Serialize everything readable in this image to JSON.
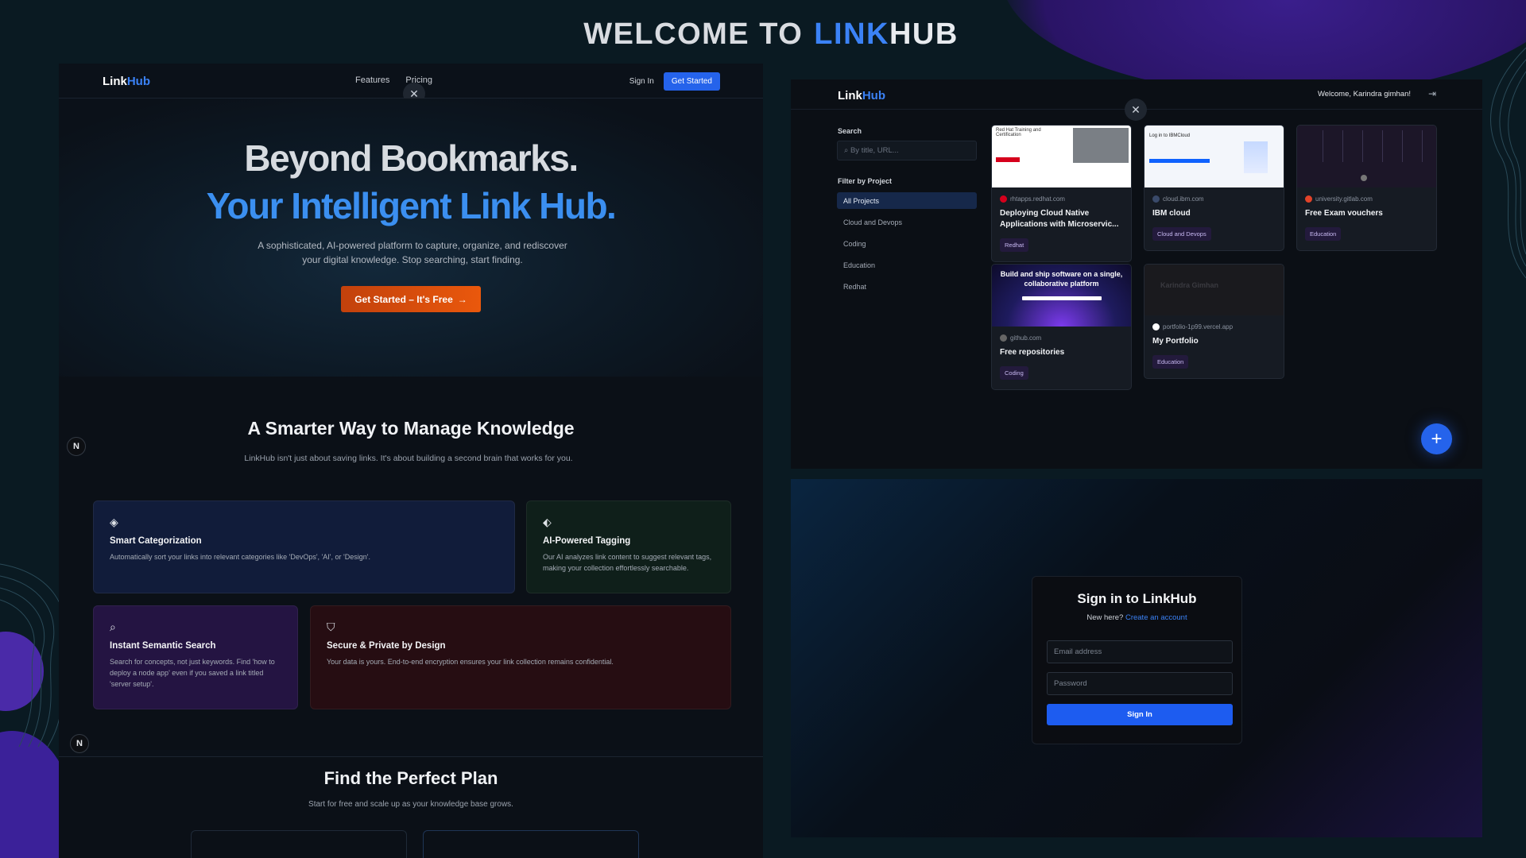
{
  "banner": {
    "prefix": "WELCOME TO",
    "link": "LINK",
    "hub": "HUB"
  },
  "landing": {
    "logo_a": "Link",
    "logo_b": "Hub",
    "nav": {
      "features": "Features",
      "pricing": "Pricing",
      "signin": "Sign In",
      "get_started": "Get Started"
    },
    "hero": {
      "title1": "Beyond Bookmarks.",
      "title2": "Your Intelligent Link Hub.",
      "desc": "A sophisticated, AI-powered platform to capture, organize, and rediscover your digital knowledge. Stop searching, start finding.",
      "cta": "Get Started – It's Free"
    },
    "features": {
      "title": "A Smarter Way to Manage Knowledge",
      "subtitle": "LinkHub isn't just about saving links. It's about building a second brain that works for you.",
      "cards": [
        {
          "title": "Smart Categorization",
          "desc": "Automatically sort your links into relevant categories like 'DevOps', 'AI', or 'Design'."
        },
        {
          "title": "AI-Powered Tagging",
          "desc": "Our AI analyzes link content to suggest relevant tags, making your collection effortlessly searchable."
        },
        {
          "title": "Instant Semantic Search",
          "desc": "Search for concepts, not just keywords. Find 'how to deploy a node app' even if you saved a link titled 'server setup'."
        },
        {
          "title": "Secure & Private by Design",
          "desc": "Your data is yours. End-to-end encryption ensures your link collection remains confidential."
        }
      ]
    },
    "pricing": {
      "title": "Find the Perfect Plan",
      "subtitle": "Start for free and scale up as your knowledge base grows."
    },
    "badge": "N"
  },
  "dashboard": {
    "logo_a": "Link",
    "logo_b": "Hub",
    "welcome": "Welcome, Karindra gimhan!",
    "search_label": "Search",
    "search_placeholder": "By title, URL...",
    "filter_label": "Filter by Project",
    "projects": [
      "All Projects",
      "Cloud and Devops",
      "Coding",
      "Education",
      "Redhat"
    ],
    "links": [
      {
        "domain": "rhtapps.redhat.com",
        "title": "Deploying Cloud Native Applications with Microservic...",
        "tag": "Redhat",
        "thumb_text": "Red Hat Training and Certification"
      },
      {
        "domain": "cloud.ibm.com",
        "title": "IBM cloud",
        "tag": "Cloud and Devops",
        "thumb_text": "Log in to IBMCloud"
      },
      {
        "domain": "university.gitlab.com",
        "title": "Free Exam vouchers",
        "tag": "Education"
      },
      {
        "domain": "github.com",
        "title": "Free repositories",
        "tag": "Coding",
        "thumb_text": "Build and ship software on a single, collaborative platform"
      },
      {
        "domain": "portfolio-1p99.vercel.app",
        "title": "My Portfolio",
        "tag": "Education",
        "thumb_text": "Karindra Gimhan"
      }
    ],
    "fab": "+"
  },
  "signin": {
    "title": "Sign in to LinkHub",
    "new_here": "New here?",
    "create": "Create an account",
    "email_placeholder": "Email address",
    "password_placeholder": "Password",
    "button": "Sign In"
  },
  "colors": {
    "accent": "#3b82f6",
    "cta": "#ea580c",
    "primary_btn": "#2563eb"
  }
}
